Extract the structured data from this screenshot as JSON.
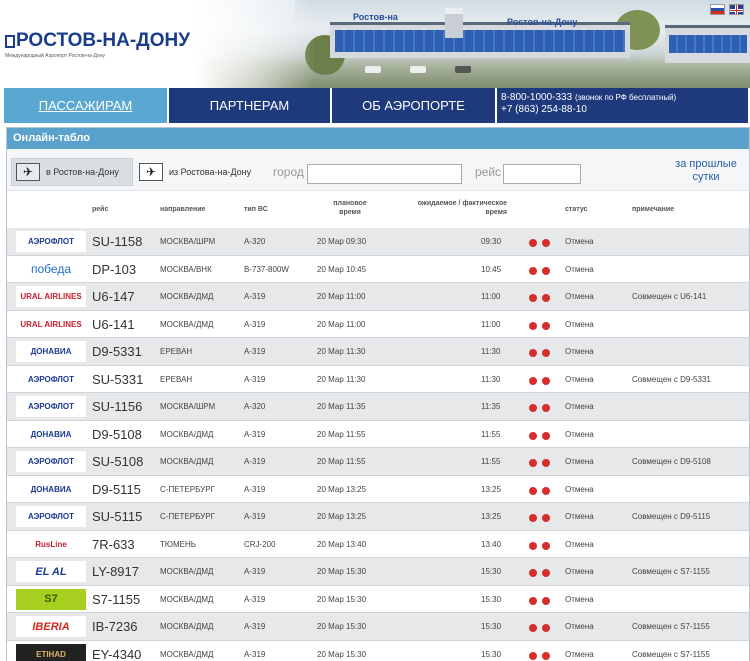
{
  "header": {
    "logo_title": "РОСТОВ-НА-ДОНУ",
    "logo_subtitle": "Международный Аэропорт Ростов-на-Дону",
    "photo_sign_left": "Ростов-на",
    "photo_sign_right": "Ростов-на-Дону",
    "languages": [
      "ru",
      "en"
    ]
  },
  "nav": {
    "items": [
      {
        "label": "ПАССАЖИРАМ",
        "active": true
      },
      {
        "label": "ПАРТНЕРАМ",
        "active": false
      },
      {
        "label": "ОБ АЭРОПОРТЕ",
        "active": false
      }
    ],
    "contact_phone1": "8-800-1000-333",
    "contact_note": "(звонок по РФ бесплатный)",
    "contact_phone2": "+7 (863) 254-88-10"
  },
  "board": {
    "title": "Онлайн-табло",
    "tab_arrivals": "в Ростов-на-Дону",
    "tab_departures": "из Ростова-на-Дону",
    "city_label": "город",
    "city_value": "",
    "flight_label": "рейс",
    "flight_value": "",
    "past_link": "за прошлые сутки",
    "headers": {
      "flight": "рейс",
      "direction": "направление",
      "aircraft": "тип ВС",
      "planned": "плановое время",
      "actual": "ожидаемое / фактическое время",
      "status": "статус",
      "note": "примечание"
    },
    "rows": [
      {
        "logo": "АЭРОФЛОТ",
        "logo_color": "#1c3a8e",
        "logo_bg": "#ffffff",
        "flight": "SU-1158",
        "direction": "МОСКВА/ШРМ",
        "aircraft": "A-320",
        "planned": "20 Мар 09:30",
        "actual": "09:30",
        "status": "Отмена",
        "note": ""
      },
      {
        "logo": "победа",
        "logo_color": "#1e6fc8",
        "logo_bg": "#ffffff",
        "flight": "DP-103",
        "direction": "МОСКВА/ВНК",
        "aircraft": "B-737-800W",
        "planned": "20 Мар 10:45",
        "actual": "10:45",
        "status": "Отмена",
        "note": ""
      },
      {
        "logo": "URAL AIRLINES",
        "logo_color": "#c8202e",
        "logo_bg": "#ffffff",
        "flight": "U6-147",
        "direction": "МОСКВА/ДМД",
        "aircraft": "A-319",
        "planned": "20 Мар 11:00",
        "actual": "11:00",
        "status": "Отмена",
        "note": "Совмещен с U6-141"
      },
      {
        "logo": "URAL AIRLINES",
        "logo_color": "#c8202e",
        "logo_bg": "#ffffff",
        "flight": "U6-141",
        "direction": "МОСКВА/ДМД",
        "aircraft": "A-319",
        "planned": "20 Мар 11:00",
        "actual": "11:00",
        "status": "Отмена",
        "note": ""
      },
      {
        "logo": "ДОНАВИА",
        "logo_color": "#1c3a8e",
        "logo_bg": "#ffffff",
        "flight": "D9-5331",
        "direction": "ЕРЕВАН",
        "aircraft": "A-319",
        "planned": "20 Мар 11:30",
        "actual": "11:30",
        "status": "Отмена",
        "note": ""
      },
      {
        "logo": "АЭРОФЛОТ",
        "logo_color": "#1c3a8e",
        "logo_bg": "#ffffff",
        "flight": "SU-5331",
        "direction": "ЕРЕВАН",
        "aircraft": "A-319",
        "planned": "20 Мар 11:30",
        "actual": "11:30",
        "status": "Отмена",
        "note": "Совмещен с D9-5331"
      },
      {
        "logo": "АЭРОФЛОТ",
        "logo_color": "#1c3a8e",
        "logo_bg": "#ffffff",
        "flight": "SU-1156",
        "direction": "МОСКВА/ШРМ",
        "aircraft": "A-320",
        "planned": "20 Мар 11:35",
        "actual": "11:35",
        "status": "Отмена",
        "note": ""
      },
      {
        "logo": "ДОНАВИА",
        "logo_color": "#1c3a8e",
        "logo_bg": "#ffffff",
        "flight": "D9-5108",
        "direction": "МОСКВА/ДМД",
        "aircraft": "A-319",
        "planned": "20 Мар 11:55",
        "actual": "11:55",
        "status": "Отмена",
        "note": ""
      },
      {
        "logo": "АЭРОФЛОТ",
        "logo_color": "#1c3a8e",
        "logo_bg": "#ffffff",
        "flight": "SU-5108",
        "direction": "МОСКВА/ДМД",
        "aircraft": "A-319",
        "planned": "20 Мар 11:55",
        "actual": "11:55",
        "status": "Отмена",
        "note": "Совмещен с D9-5108"
      },
      {
        "logo": "ДОНАВИА",
        "logo_color": "#1c3a8e",
        "logo_bg": "#ffffff",
        "flight": "D9-5115",
        "direction": "С-ПЕТЕРБУРГ",
        "aircraft": "A-319",
        "planned": "20 Мар 13:25",
        "actual": "13:25",
        "status": "Отмена",
        "note": ""
      },
      {
        "logo": "АЭРОФЛОТ",
        "logo_color": "#1c3a8e",
        "logo_bg": "#ffffff",
        "flight": "SU-5115",
        "direction": "С-ПЕТЕРБУРГ",
        "aircraft": "A-319",
        "planned": "20 Мар 13:25",
        "actual": "13:25",
        "status": "Отмена",
        "note": "Совмещен с D9-5115"
      },
      {
        "logo": "RusLine",
        "logo_color": "#c8202e",
        "logo_bg": "#ffffff",
        "flight": "7R-633",
        "direction": "ТЮМЕНЬ",
        "aircraft": "CRJ-200",
        "planned": "20 Мар 13:40",
        "actual": "13:40",
        "status": "Отмена",
        "note": ""
      },
      {
        "logo": "EL AL",
        "logo_color": "#1c3a8e",
        "logo_bg": "#ffffff",
        "flight": "LY-8917",
        "direction": "МОСКВА/ДМД",
        "aircraft": "A-319",
        "planned": "20 Мар 15:30",
        "actual": "15:30",
        "status": "Отмена",
        "note": "Совмещен с S7-1155"
      },
      {
        "logo": "S7",
        "logo_color": "#3a5d00",
        "logo_bg": "#a6cf1f",
        "flight": "S7-1155",
        "direction": "МОСКВА/ДМД",
        "aircraft": "A-319",
        "planned": "20 Мар 15:30",
        "actual": "15:30",
        "status": "Отмена",
        "note": ""
      },
      {
        "logo": "IBERIA",
        "logo_color": "#d22a1e",
        "logo_bg": "#ffffff",
        "flight": "IB-7236",
        "direction": "МОСКВА/ДМД",
        "aircraft": "A-319",
        "planned": "20 Мар 15:30",
        "actual": "15:30",
        "status": "Отмена",
        "note": "Совмещен с S7-1155"
      },
      {
        "logo": "ETIHAD",
        "logo_color": "#d7b46a",
        "logo_bg": "#222222",
        "flight": "EY-4340",
        "direction": "МОСКВА/ДМД",
        "aircraft": "A-319",
        "planned": "20 Мар 15:30",
        "actual": "15:30",
        "status": "Отмена",
        "note": "Совмещен с S7-1155"
      }
    ]
  }
}
